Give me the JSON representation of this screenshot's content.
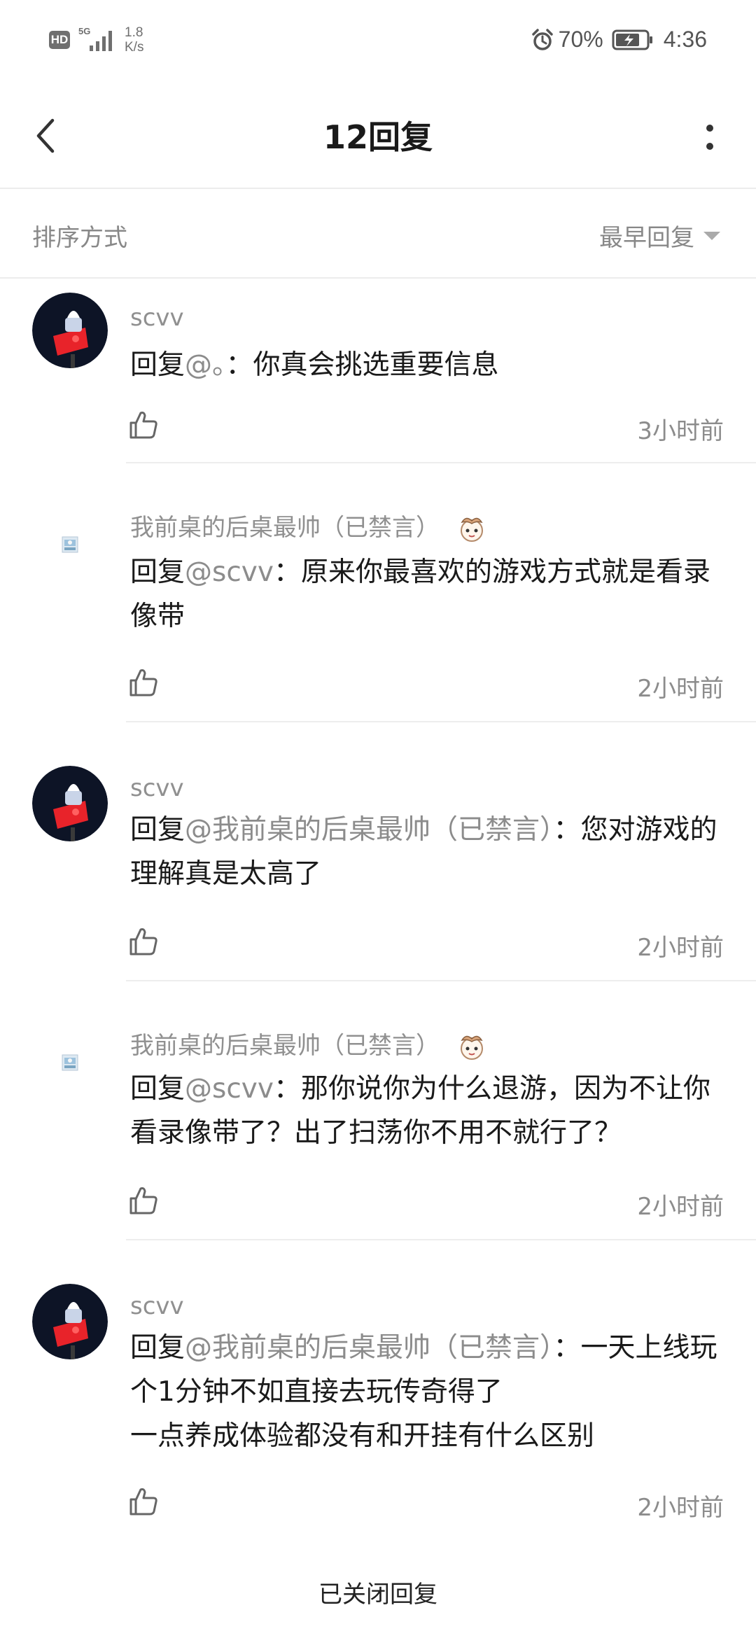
{
  "status_bar": {
    "hd": "HD",
    "network": "5G",
    "speed_value": "1.8",
    "speed_unit": "K/s",
    "battery": "70%",
    "time": "4:36",
    "icons": [
      "alarm-icon",
      "battery-icon",
      "signal-icon"
    ]
  },
  "header": {
    "title": "12回复",
    "back_icon": "back-arrow-icon",
    "more_icon": "more-vertical-icon"
  },
  "sort": {
    "label": "排序方式",
    "value": "最早回复"
  },
  "comments": [
    {
      "user": "scvv",
      "prefix": "回复",
      "mention": "@。",
      "body": "：你真会挑选重要信息",
      "time": "3小时前"
    },
    {
      "user": "我前桌的后桌最帅（已禁言）",
      "prefix": "回复",
      "mention": "@scvv",
      "body": "：原来你最喜欢的游戏方式就是看录像带",
      "time": "2小时前"
    },
    {
      "user": "scvv",
      "prefix": "回复",
      "mention": "@我前桌的后桌最帅（已禁言）",
      "body": "：您对游戏的理解真是太高了",
      "time": "2小时前"
    },
    {
      "user": "我前桌的后桌最帅（已禁言）",
      "prefix": "回复",
      "mention": "@scvv",
      "body": "：那你说你为什么退游，因为不让你看录像带了？出了扫荡你不用不就行了？",
      "time": "2小时前"
    },
    {
      "user": "scvv",
      "prefix": "回复",
      "mention": "@我前桌的后桌最帅（已禁言）",
      "body": "：一天上线玩个1分钟不如直接去玩传奇得了\n一点养成体验都没有和开挂有什么区别",
      "time": "2小时前"
    }
  ],
  "footer": {
    "closed_note": "已关闭回复"
  },
  "colors": {
    "text_primary": "#1a1a1a",
    "text_secondary": "#8c8c8c",
    "divider": "#ececec",
    "avatar_bg": "#0d1426",
    "avatar_accent": "#e8232a"
  }
}
